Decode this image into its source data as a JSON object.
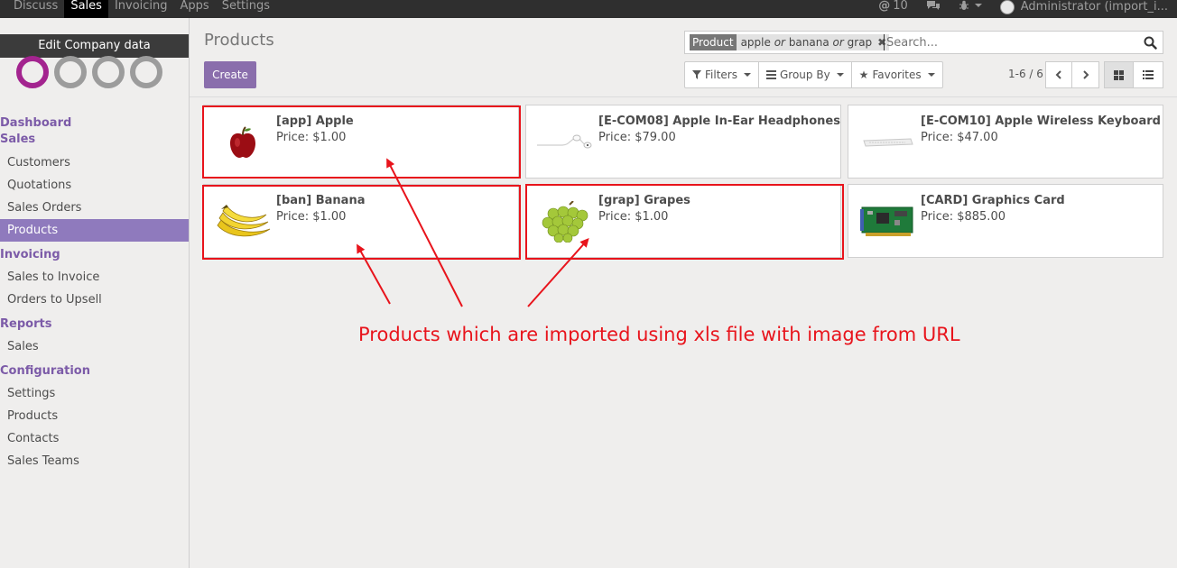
{
  "topbar": {
    "menu": [
      {
        "label": "Discuss",
        "active": false
      },
      {
        "label": "Sales",
        "active": true
      },
      {
        "label": "Invoicing",
        "active": false
      },
      {
        "label": "Apps",
        "active": false
      },
      {
        "label": "Settings",
        "active": false
      }
    ],
    "messages_count": "10",
    "user_label": "Administrator (import_i..."
  },
  "sidebar": {
    "company_button": "Edit Company data",
    "sections": [
      {
        "title": "Dashboard",
        "items": []
      },
      {
        "title": "Sales",
        "items": [
          "Customers",
          "Quotations",
          "Sales Orders",
          "Products"
        ]
      },
      {
        "title": "Invoicing",
        "items": [
          "Sales to Invoice",
          "Orders to Upsell"
        ]
      },
      {
        "title": "Reports",
        "items": [
          "Sales"
        ]
      },
      {
        "title": "Configuration",
        "items": [
          "Settings",
          "Products",
          "Contacts",
          "Sales Teams"
        ]
      }
    ],
    "active_item": "Products"
  },
  "control_panel": {
    "title": "Products",
    "create_label": "Create",
    "search": {
      "facet_key": "Product",
      "facet_values": [
        "apple",
        "banana",
        "grap"
      ],
      "facet_separator": "or",
      "placeholder": "Search..."
    },
    "filters_label": "Filters",
    "groupby_label": "Group By",
    "favorites_label": "Favorites",
    "pager": "1-6 / 6"
  },
  "products": [
    {
      "name": "[app] Apple",
      "price": "Price: $1.00",
      "image": "apple",
      "highlighted": true
    },
    {
      "name": "[E-COM08] Apple In-Ear Headphones",
      "price": "Price: $79.00",
      "image": "headphones",
      "highlighted": false
    },
    {
      "name": "[E-COM10] Apple Wireless Keyboard",
      "price": "Price: $47.00",
      "image": "keyboard",
      "highlighted": false
    },
    {
      "name": "[ban] Banana",
      "price": "Price: $1.00",
      "image": "banana",
      "highlighted": true
    },
    {
      "name": "[grap] Grapes",
      "price": "Price: $1.00",
      "image": "grapes",
      "highlighted": true
    },
    {
      "name": "[CARD] Graphics Card",
      "price": "Price: $885.00",
      "image": "graphics-card",
      "highlighted": false
    }
  ],
  "annotation": {
    "text": "Products which are imported using xls file with image from URL",
    "color": "#e8141c"
  },
  "colors": {
    "brand": "#8a6eac",
    "active_nav": "#8f7abd",
    "section_title": "#7c5ba8"
  }
}
